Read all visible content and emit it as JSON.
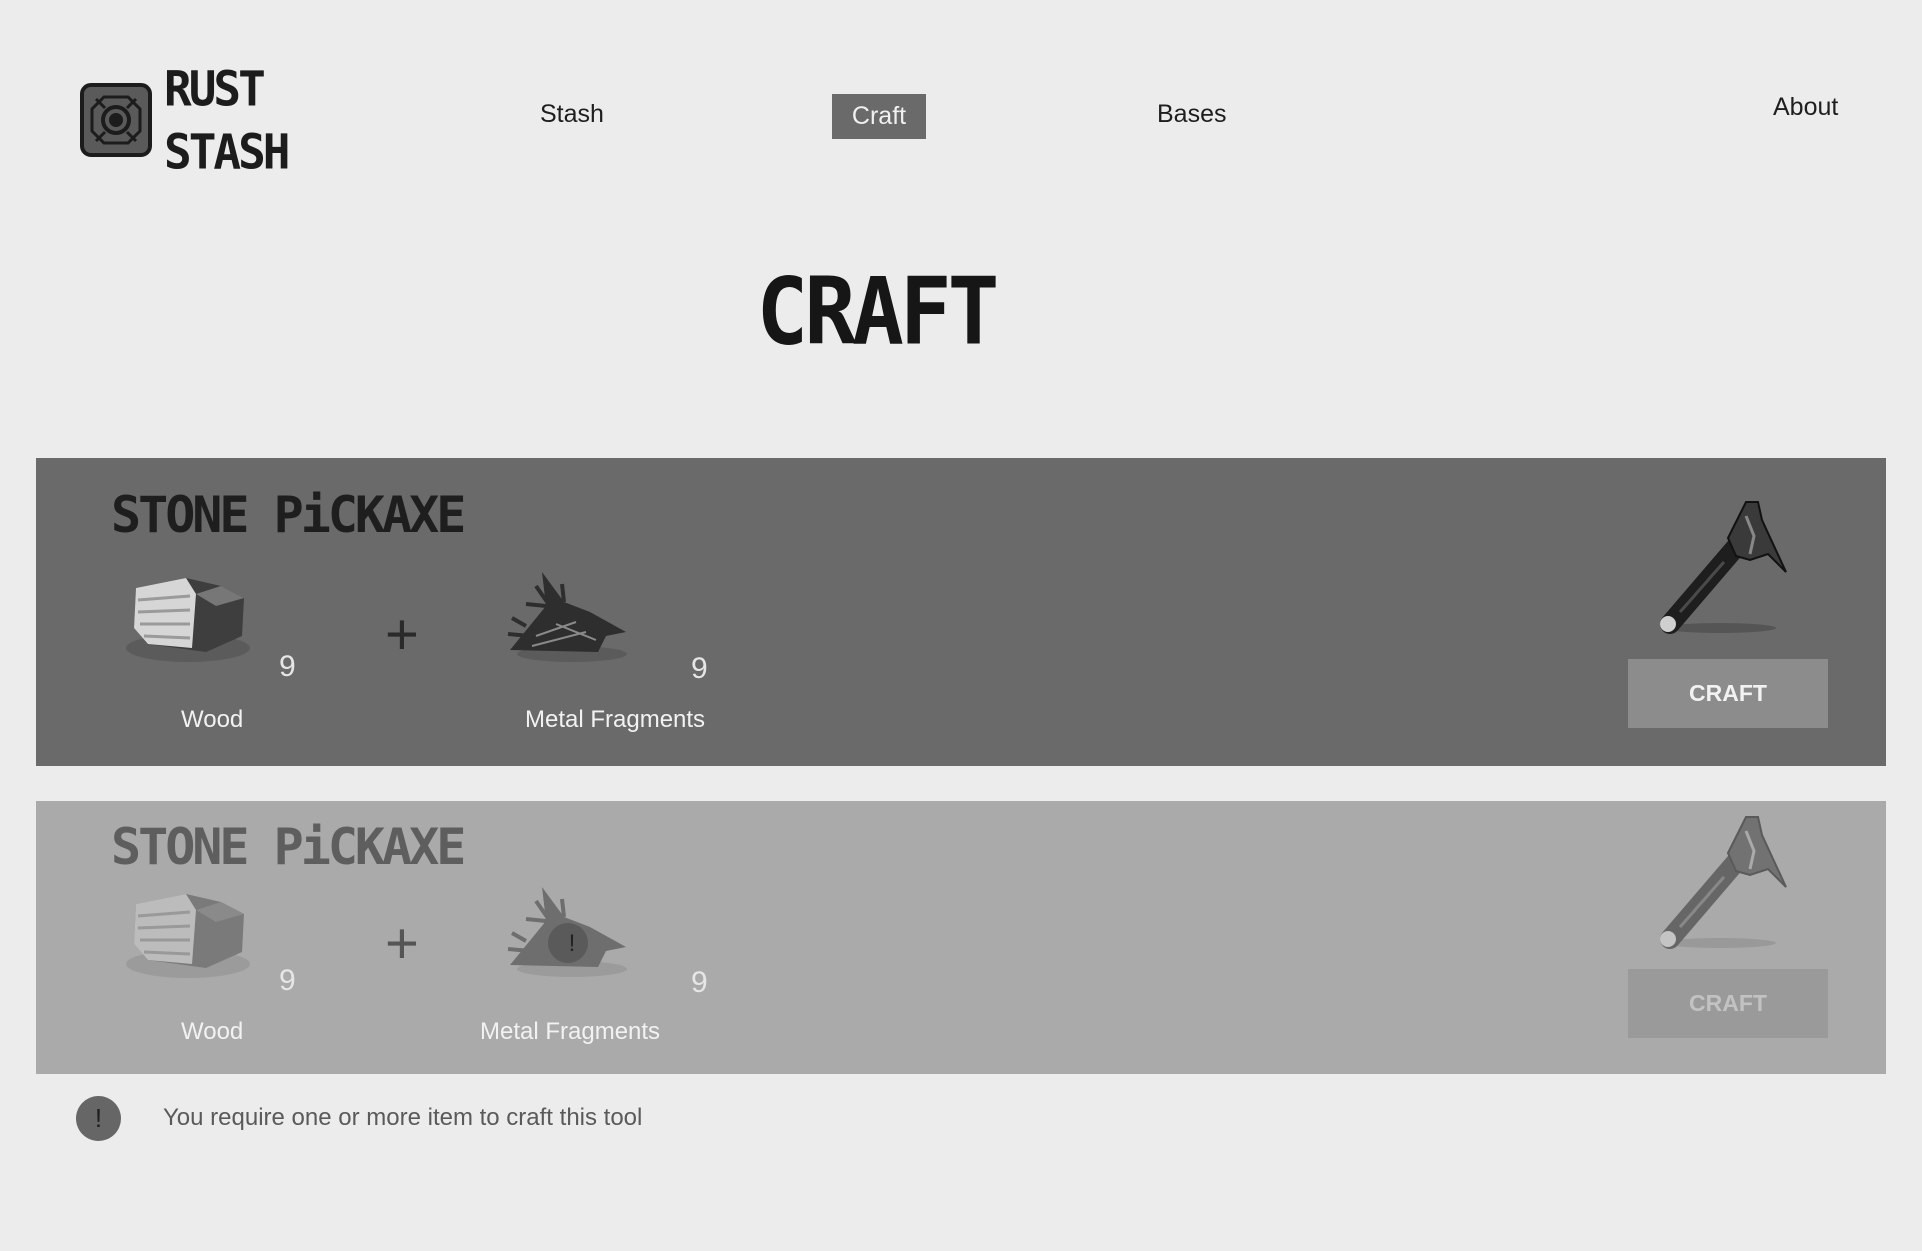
{
  "brand": {
    "line1": "RUST",
    "line2": "STASH"
  },
  "nav": {
    "stash": "Stash",
    "craft": "Craft",
    "bases": "Bases",
    "about": "About",
    "active": "craft"
  },
  "page_title": "CRAFT",
  "recipes": [
    {
      "title": "STONE PiCKAXE",
      "plus": "+",
      "ingredients": [
        {
          "name": "Wood",
          "qty": "9"
        },
        {
          "name": "Metal Fragments",
          "qty": "9"
        }
      ],
      "craft_label": "CRAFT",
      "enabled": true
    },
    {
      "title": "STONE PiCKAXE",
      "plus": "+",
      "ingredients": [
        {
          "name": "Wood",
          "qty": "9"
        },
        {
          "name": "Metal Fragments",
          "qty": "9",
          "missing_mark": "!"
        }
      ],
      "craft_label": "CRAFT",
      "enabled": false
    }
  ],
  "warning": {
    "icon": "!",
    "text": "You require one or more item to craft this tool"
  },
  "colors": {
    "background": "#ececec",
    "card_enabled": "#6a6a6a",
    "card_disabled": "#aaaaaa",
    "nav_active": "#6a6a6a"
  }
}
